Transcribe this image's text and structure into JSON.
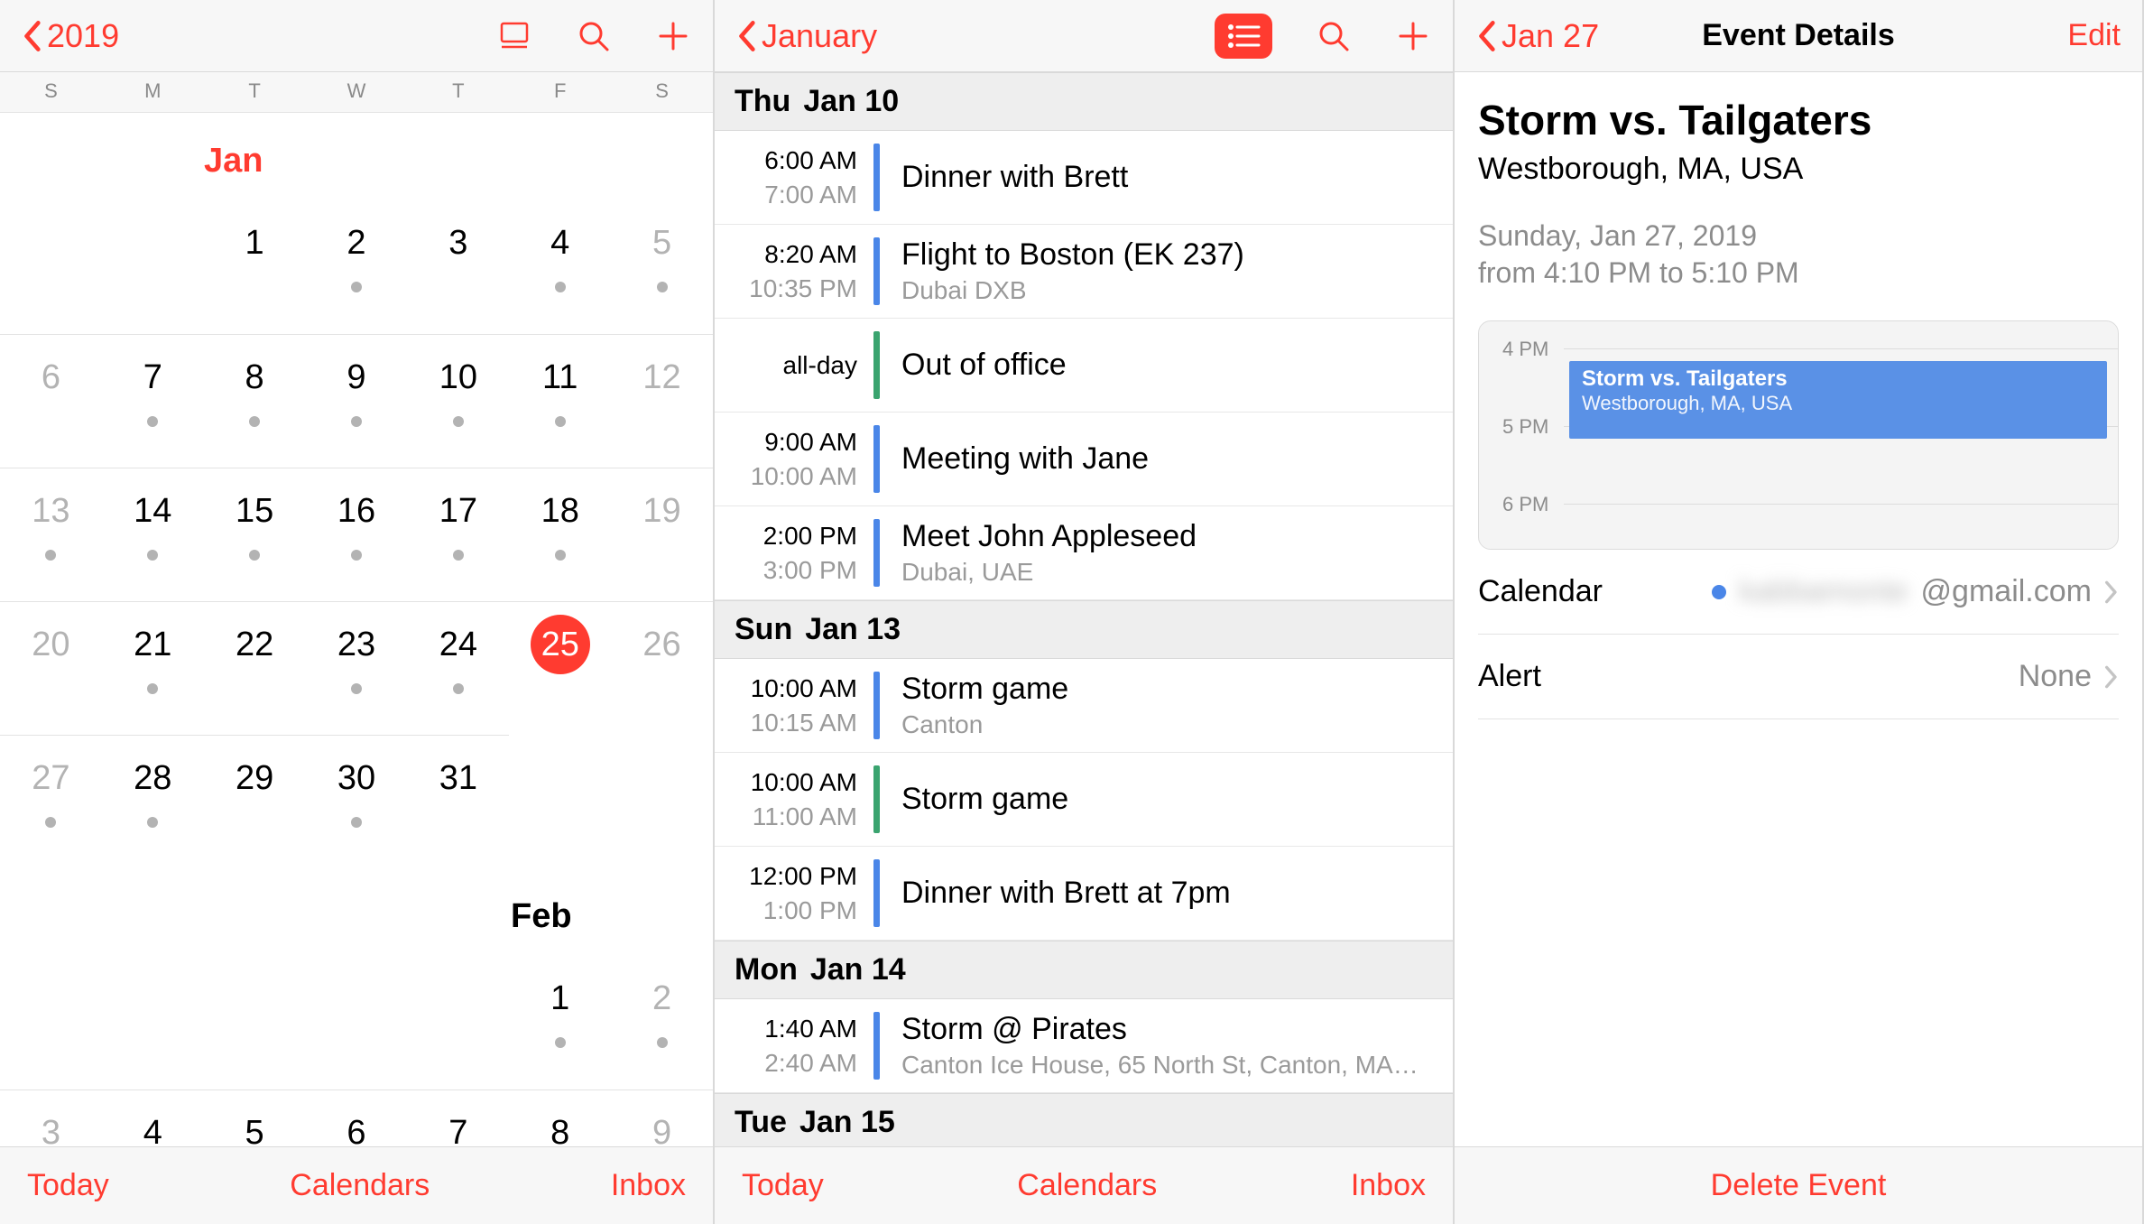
{
  "pane1": {
    "back": "2019",
    "dow": [
      "S",
      "M",
      "T",
      "W",
      "T",
      "F",
      "S"
    ],
    "months": {
      "jan": "Jan",
      "feb": "Feb"
    },
    "toolbar": {
      "today": "Today",
      "calendars": "Calendars",
      "inbox": "Inbox"
    },
    "grid_jan": [
      [
        null,
        null,
        {
          "n": "1"
        },
        {
          "n": "2",
          "dot": true
        },
        {
          "n": "3"
        },
        {
          "n": "4",
          "dot": true
        },
        {
          "n": "5",
          "gray": true,
          "dot": true
        }
      ],
      [
        {
          "n": "6",
          "gray": true
        },
        {
          "n": "7",
          "dot": true
        },
        {
          "n": "8",
          "dot": true
        },
        {
          "n": "9",
          "dot": true
        },
        {
          "n": "10",
          "dot": true
        },
        {
          "n": "11",
          "dot": true
        },
        {
          "n": "12",
          "gray": true
        }
      ],
      [
        {
          "n": "13",
          "gray": true,
          "dot": true
        },
        {
          "n": "14",
          "dot": true
        },
        {
          "n": "15",
          "dot": true
        },
        {
          "n": "16",
          "dot": true
        },
        {
          "n": "17",
          "dot": true
        },
        {
          "n": "18",
          "dot": true
        },
        {
          "n": "19",
          "gray": true
        }
      ],
      [
        {
          "n": "20",
          "gray": true
        },
        {
          "n": "21",
          "dot": true
        },
        {
          "n": "22"
        },
        {
          "n": "23",
          "dot": true
        },
        {
          "n": "24",
          "dot": true
        },
        {
          "n": "25",
          "today": true
        },
        {
          "n": "26",
          "gray": true
        }
      ],
      [
        {
          "n": "27",
          "gray": true,
          "dot": true
        },
        {
          "n": "28",
          "dot": true
        },
        {
          "n": "29"
        },
        {
          "n": "30",
          "dot": true
        },
        {
          "n": "31"
        },
        null,
        null
      ]
    ],
    "grid_feb": [
      [
        null,
        null,
        null,
        null,
        null,
        {
          "n": "1",
          "dot": true
        },
        {
          "n": "2",
          "gray": true,
          "dot": true
        }
      ],
      [
        {
          "n": "3",
          "gray": true
        },
        {
          "n": "4"
        },
        {
          "n": "5",
          "dot": true
        },
        {
          "n": "6"
        },
        {
          "n": "7"
        },
        {
          "n": "8"
        },
        {
          "n": "9",
          "gray": true
        }
      ]
    ]
  },
  "pane2": {
    "back": "January",
    "toolbar": {
      "today": "Today",
      "calendars": "Calendars",
      "inbox": "Inbox"
    },
    "days": [
      {
        "wd": "Thu",
        "dt": "Jan 10",
        "events": [
          {
            "t1": "6:00 AM",
            "t2": "7:00 AM",
            "title": "Dinner with Brett",
            "bar": "blue"
          },
          {
            "t1": "8:20 AM",
            "t2": "10:35 PM",
            "title": "Flight to Boston (EK 237)",
            "sub": "Dubai DXB",
            "bar": "blue"
          },
          {
            "t1": "all-day",
            "title": "Out of office",
            "bar": "green"
          },
          {
            "t1": "9:00 AM",
            "t2": "10:00 AM",
            "title": "Meeting with Jane",
            "bar": "blue"
          },
          {
            "t1": "2:00 PM",
            "t2": "3:00 PM",
            "title": "Meet John Appleseed",
            "sub": "Dubai, UAE",
            "bar": "blue"
          }
        ]
      },
      {
        "wd": "Sun",
        "dt": "Jan 13",
        "events": [
          {
            "t1": "10:00 AM",
            "t2": "10:15 AM",
            "title": "Storm game",
            "sub": "Canton",
            "bar": "blue"
          },
          {
            "t1": "10:00 AM",
            "t2": "11:00 AM",
            "title": "Storm game",
            "bar": "green"
          },
          {
            "t1": "12:00 PM",
            "t2": "1:00 PM",
            "title": "Dinner with Brett at 7pm",
            "bar": "blue"
          }
        ]
      },
      {
        "wd": "Mon",
        "dt": "Jan 14",
        "events": [
          {
            "t1": "1:40 AM",
            "t2": "2:40 AM",
            "title": "Storm @ Pirates",
            "sub": "Canton Ice House, 65 North St, Canton, MA…",
            "bar": "blue"
          }
        ]
      },
      {
        "wd": "Tue",
        "dt": "Jan 15",
        "events": []
      }
    ]
  },
  "pane3": {
    "back": "Jan 27",
    "title": "Event Details",
    "edit": "Edit",
    "event": {
      "name": "Storm vs. Tailgaters",
      "location": "Westborough, MA, USA",
      "date": "Sunday, Jan 27, 2019",
      "range": "from 4:10 PM to 5:10 PM"
    },
    "mini": {
      "hours": [
        "4 PM",
        "5 PM",
        "6 PM"
      ],
      "block_title": "Storm vs. Tailgaters",
      "block_loc": "Westborough, MA, USA"
    },
    "settings": {
      "calendar_label": "Calendar",
      "calendar_value": "@gmail.com",
      "calendar_hidden": "kabbamonte",
      "alert_label": "Alert",
      "alert_value": "None"
    },
    "delete": "Delete Event"
  }
}
